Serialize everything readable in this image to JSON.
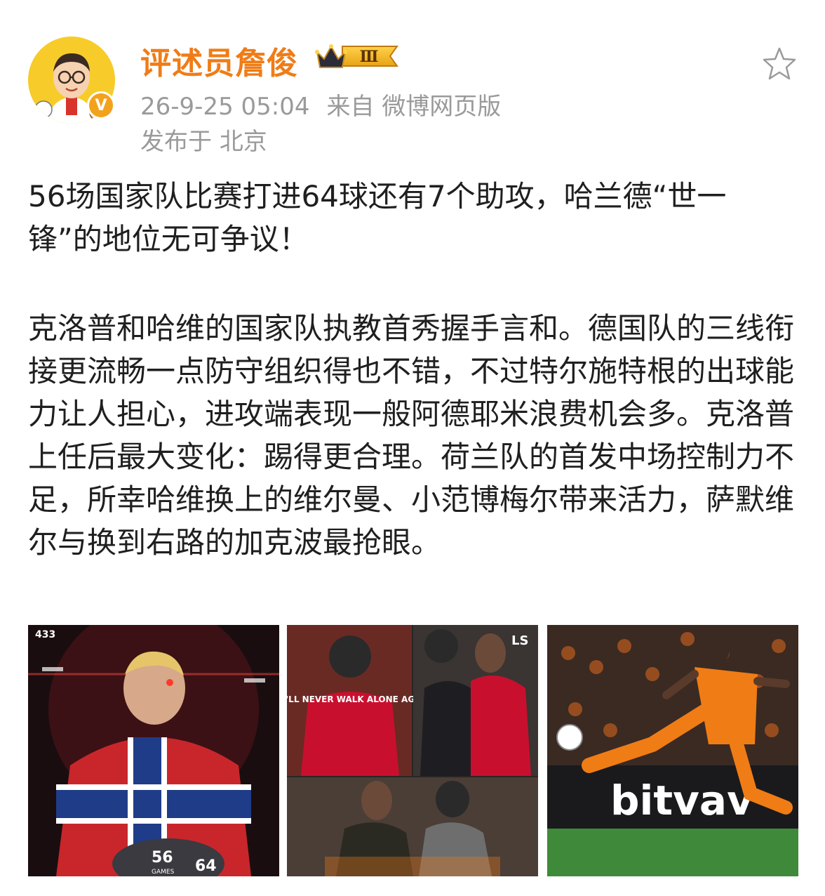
{
  "author": {
    "name": "评述员詹俊",
    "vip_level": "Ⅲ",
    "verified_mark": "V"
  },
  "meta": {
    "timestamp": "26-9-25 05:04",
    "source_prefix": "来自",
    "source": "微博网页版",
    "location_prefix": "发布于",
    "location": "北京"
  },
  "post": {
    "paragraph1": "56场国家队比赛打进64球还有7个助攻，哈兰德“世一锋”的地位无可争议！",
    "paragraph2": "克洛普和哈维的国家队执教首秀握手言和。德国队的三线衔接更流畅一点防守组织得也不错，不过特尔施特根的出球能力让人担心，进攻端表现一般阿德耶米浪费机会多。克洛普上任后最大变化：踢得更合理。荷兰队的首发中场控制力不足，所幸哈维换上的维尔曼、小范博梅尔带来活力，萨默维尔与换到右路的加克波最抢眼。"
  },
  "images": {
    "image1": {
      "corner_tag": "433",
      "ball_text_a": "56",
      "ball_text_b": "GAMES",
      "ball_text_c": "64"
    },
    "image2": {
      "corner_tag": "LS",
      "shirt_text": "I'LL NEVER WALK ALONE AGAIN"
    },
    "image3": {
      "board_text": "bitvav"
    }
  },
  "icons": {
    "favorite": "star-outline-icon",
    "crown": "crown-icon"
  },
  "colors": {
    "username": "#f07c16",
    "meta": "#9a9a9a",
    "avatar_bg": "#f7cc2a",
    "badge": "#f3a21c"
  }
}
